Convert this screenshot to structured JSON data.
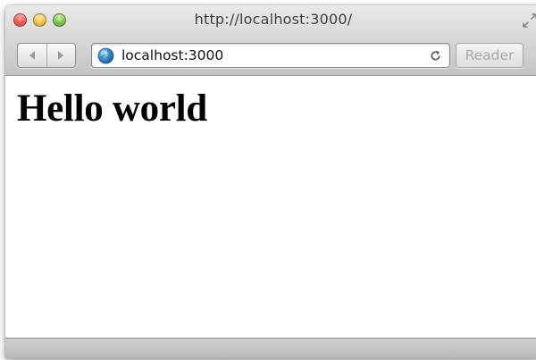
{
  "window": {
    "title": "http://localhost:3000/",
    "buttons": {
      "close": "close",
      "minimize": "minimize",
      "zoom": "zoom"
    }
  },
  "toolbar": {
    "back_icon": "back-arrow-icon",
    "forward_icon": "forward-arrow-icon",
    "address": {
      "value": "localhost:3000",
      "site_icon": "globe-icon",
      "reload_icon": "reload-icon"
    },
    "reader_label": "Reader",
    "fullscreen_icon": "fullscreen-icon"
  },
  "page": {
    "heading": "Hello world"
  },
  "colors": {
    "close": "#f0584d",
    "minimize": "#f6c341",
    "zoom": "#80c548",
    "reader_text": "#a8a8a8"
  }
}
